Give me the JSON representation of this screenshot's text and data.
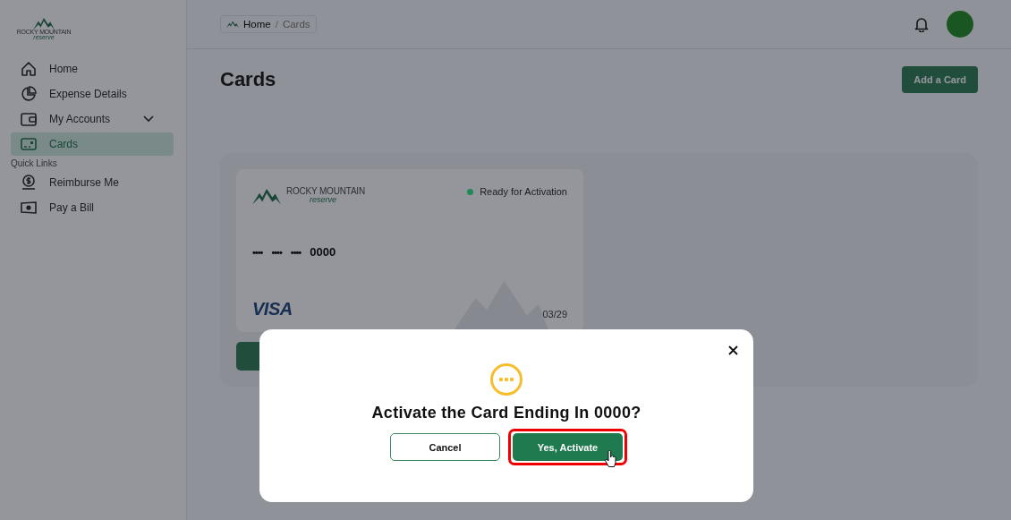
{
  "logo": {
    "name": "ROCKY MOUNTAIN",
    "tagline": "reserve"
  },
  "sidebar": {
    "items": [
      {
        "label": "Home",
        "selected": false,
        "expandable": false
      },
      {
        "label": "Expense Details",
        "selected": false,
        "expandable": false
      },
      {
        "label": "My Accounts",
        "selected": false,
        "expandable": true
      },
      {
        "label": "Cards",
        "selected": true,
        "expandable": false
      }
    ],
    "section_title": "Quick Links",
    "quick_links": [
      {
        "label": "Reimburse Me",
        "selected": false
      },
      {
        "label": "Pay a Bill",
        "selected": false
      }
    ]
  },
  "breadcrumb": [
    {
      "label": "Home",
      "current": false
    },
    {
      "label": "Cards",
      "current": true
    }
  ],
  "breadcrumb_separator": "/",
  "page_title": "Cards",
  "add_button": "Add a Card",
  "card": {
    "brand_name": "ROCKY MOUNTAIN",
    "brand_tagline": "reserve",
    "status": {
      "label": "Ready for Activation",
      "color": "#1e8a55"
    },
    "masked_groups": [
      "••••",
      "••••",
      "••••"
    ],
    "last4": "0000",
    "network": "VISA",
    "expiry": "03/29"
  },
  "dialog": {
    "title": "Activate the Card Ending In 0000?",
    "buttons": [
      {
        "label": "Cancel",
        "kind": "secondary",
        "highlighted": false
      },
      {
        "label": "Yes, Activate",
        "kind": "primary",
        "highlighted": true
      }
    ]
  }
}
